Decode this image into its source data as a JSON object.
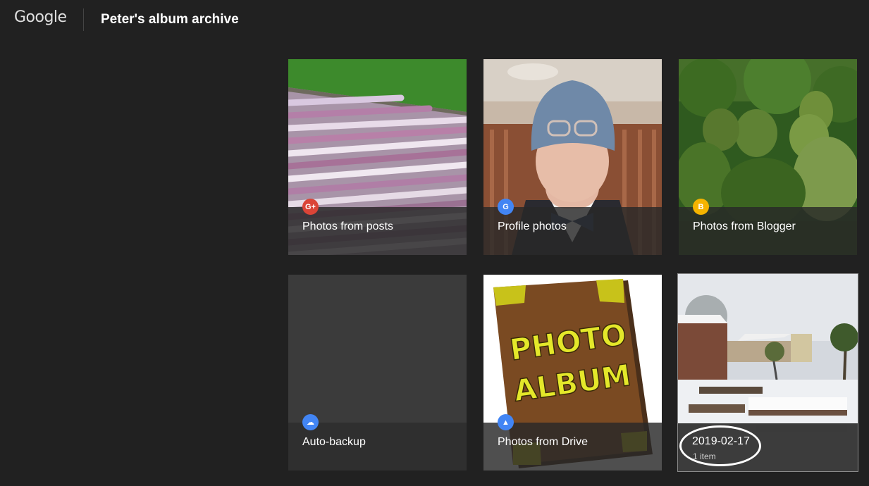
{
  "header": {
    "logo": "Google",
    "title": "Peter's album archive"
  },
  "albums": [
    {
      "label": "Photos from posts",
      "badge_icon": "google-plus-icon",
      "badge_text": "G+",
      "badge_color": "#db4437"
    },
    {
      "label": "Profile photos",
      "badge_icon": "google-icon",
      "badge_text": "G",
      "badge_color": "#4285f4"
    },
    {
      "label": "Photos from Blogger",
      "badge_icon": "blogger-icon",
      "badge_text": "B",
      "badge_color": "#f4b400"
    },
    {
      "label": "Auto-backup",
      "badge_icon": "cloud-upload-icon",
      "badge_text": "☁",
      "badge_color": "#4285f4"
    },
    {
      "label": "Photos from Drive",
      "badge_icon": "drive-icon",
      "badge_text": "▲",
      "badge_color": "#4285f4"
    },
    {
      "label": "2019-02-17",
      "sublabel": "1 item"
    }
  ],
  "photo_album_art": {
    "line1": "PHOTO",
    "line2": "ALBUM"
  }
}
